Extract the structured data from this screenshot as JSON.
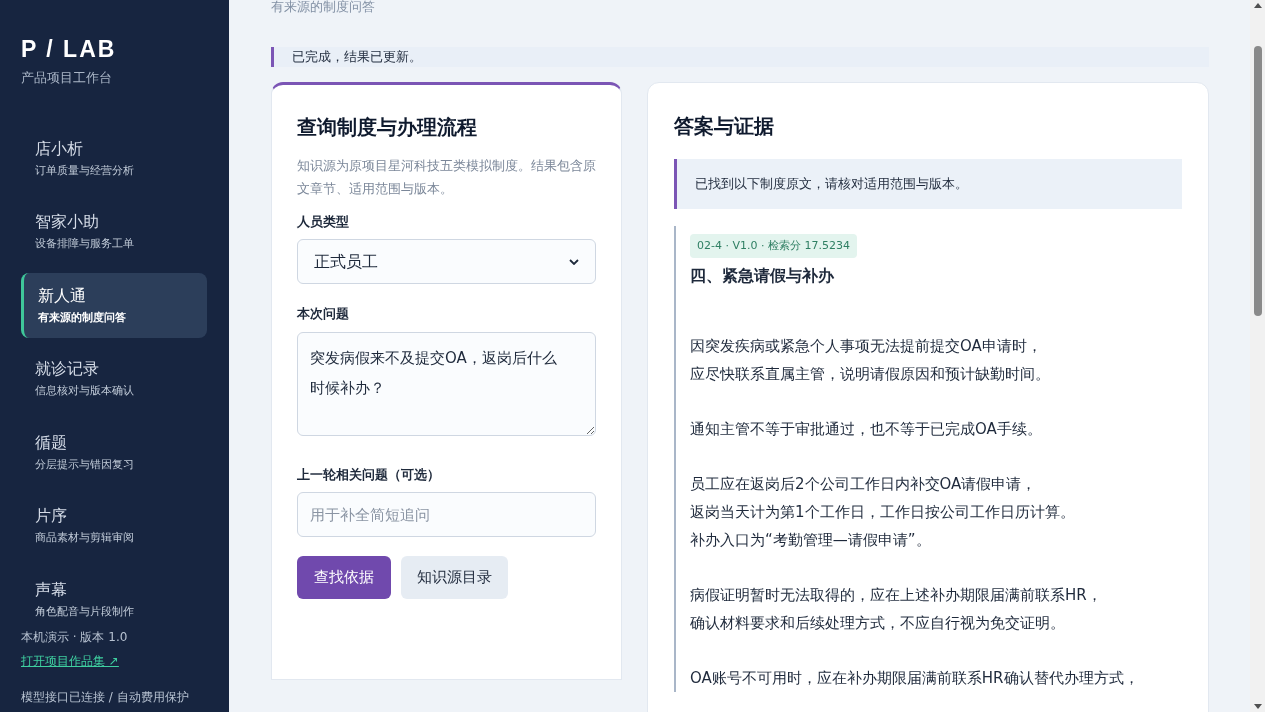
{
  "sidebar": {
    "logo": "P / LAB",
    "tagline": "产品项目工作台",
    "items": [
      {
        "title": "店小析",
        "subtitle": "订单质量与经营分析",
        "selected": false
      },
      {
        "title": "智家小助",
        "subtitle": "设备排障与服务工单",
        "selected": false
      },
      {
        "title": "新人通",
        "subtitle": "有来源的制度问答",
        "selected": true
      },
      {
        "title": "就诊记录",
        "subtitle": "信息核对与版本确认",
        "selected": false
      },
      {
        "title": "循题",
        "subtitle": "分层提示与错因复习",
        "selected": false
      },
      {
        "title": "片序",
        "subtitle": "商品素材与剪辑审阅",
        "selected": false
      },
      {
        "title": "声幕",
        "subtitle": "角色配音与片段制作",
        "selected": false
      }
    ],
    "version": "本机演示 · 版本 1.0",
    "portfolio_link": "打开项目作品集 ↗",
    "status": "模型接口已连接 / 自动费用保护"
  },
  "page_subtitle": "有来源的制度问答",
  "notice": "已完成，结果已更新。",
  "query_card": {
    "title": "查询制度与办理流程",
    "description": "知识源为原项目星河科技五类模拟制度。结果包含原文章节、适用范围与版本。",
    "person_type": {
      "label": "人员类型",
      "value": "正式员工"
    },
    "question": {
      "label": "本次问题",
      "value": "突发病假来不及提交OA，返岗后什么时候补办？"
    },
    "previous": {
      "label": "上一轮相关问题（可选）",
      "placeholder": "用于补全简短追问"
    },
    "buttons": [
      {
        "label": "查找依据",
        "kind": "primary"
      },
      {
        "label": "知识源目录",
        "kind": "secondary"
      }
    ]
  },
  "answer_card": {
    "title": "答案与证据",
    "notice": "已找到以下制度原文，请核对适用范围与版本。",
    "evidence": {
      "badge": "02-4 · V1.0 · 检索分 17.5234",
      "heading": "四、紧急请假与补办",
      "paragraphs": [
        [
          "因突发疾病或紧急个人事项无法提前提交OA申请时，",
          "应尽快联系直属主管，说明请假原因和预计缺勤时间。"
        ],
        [
          "通知主管不等于审批通过，也不等于已完成OA手续。"
        ],
        [
          "员工应在返岗后2个公司工作日内补交OA请假申请，",
          "返岗当天计为第1个工作日，工作日按公司工作日历计算。",
          "补办入口为“考勤管理—请假申请”。"
        ],
        [
          "病假证明暂时无法取得的，应在上述补办期限届满前联系HR，",
          "确认材料要求和后续处理方式，不应自行视为免交证明。"
        ],
        [
          "OA账号不可用时，应在补办期限届满前联系HR确认替代办理方式，"
        ]
      ]
    }
  }
}
